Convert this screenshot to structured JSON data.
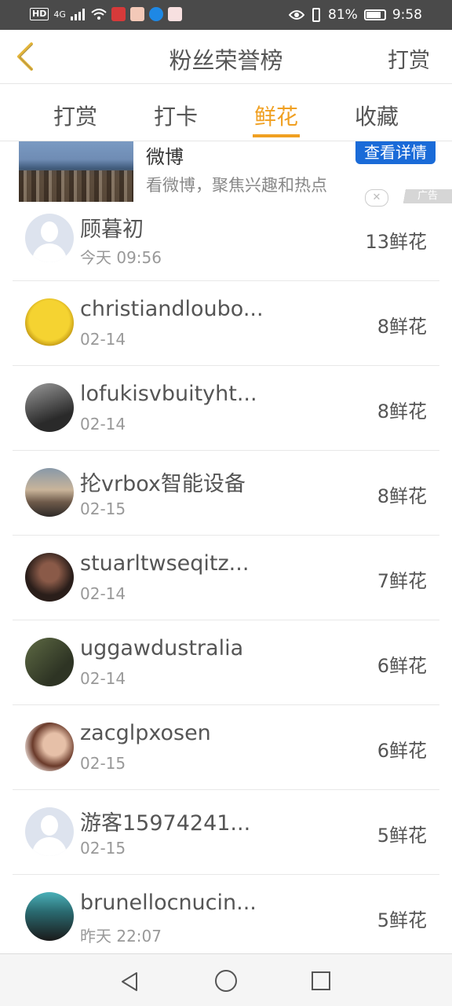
{
  "status_bar": {
    "network_tag": "HD",
    "signal": "4G",
    "battery_percent": "81%",
    "battery_level": 0.81,
    "time": "9:58"
  },
  "header": {
    "back_icon": "chevron-left-icon",
    "title": "粉丝荣誉榜",
    "right_action": "打赏",
    "accent_color": "#f0a022"
  },
  "tabs": [
    {
      "label": "打赏",
      "active": false
    },
    {
      "label": "打卡",
      "active": false
    },
    {
      "label": "鲜花",
      "active": true
    },
    {
      "label": "收藏",
      "active": false
    }
  ],
  "ad": {
    "title": "微博",
    "description": "看微博，聚焦兴趣和热点",
    "button_label": "查看详情",
    "tag": "广告",
    "close_icon": "close-icon"
  },
  "list": [
    {
      "name": "顾暮初",
      "time": "今天 09:56",
      "count": "13鲜花",
      "avatar": "default"
    },
    {
      "name": "christiandloubo...",
      "time": "02-14",
      "count": "8鲜花",
      "avatar": "yellow"
    },
    {
      "name": "lofukisvbuityht...",
      "time": "02-14",
      "count": "8鲜花",
      "avatar": "dark"
    },
    {
      "name": "抡vrbox智能设备",
      "time": "02-15",
      "count": "8鲜花",
      "avatar": "sunset"
    },
    {
      "name": "stuarltwseqitz...",
      "time": "02-14",
      "count": "7鲜花",
      "avatar": "man"
    },
    {
      "name": "uggawdustralia",
      "time": "02-14",
      "count": "6鲜花",
      "avatar": "olive"
    },
    {
      "name": "zacglpxosen",
      "time": "02-15",
      "count": "6鲜花",
      "avatar": "woman"
    },
    {
      "name": "游客15974241...",
      "time": "02-15",
      "count": "5鲜花",
      "avatar": "default"
    },
    {
      "name": "brunellocnucin...",
      "time": "昨天 22:07",
      "count": "5鲜花",
      "avatar": "teal"
    }
  ],
  "nav_bar": {
    "back_icon": "triangle-back-icon",
    "home_icon": "circle-home-icon",
    "recent_icon": "square-recent-icon"
  }
}
